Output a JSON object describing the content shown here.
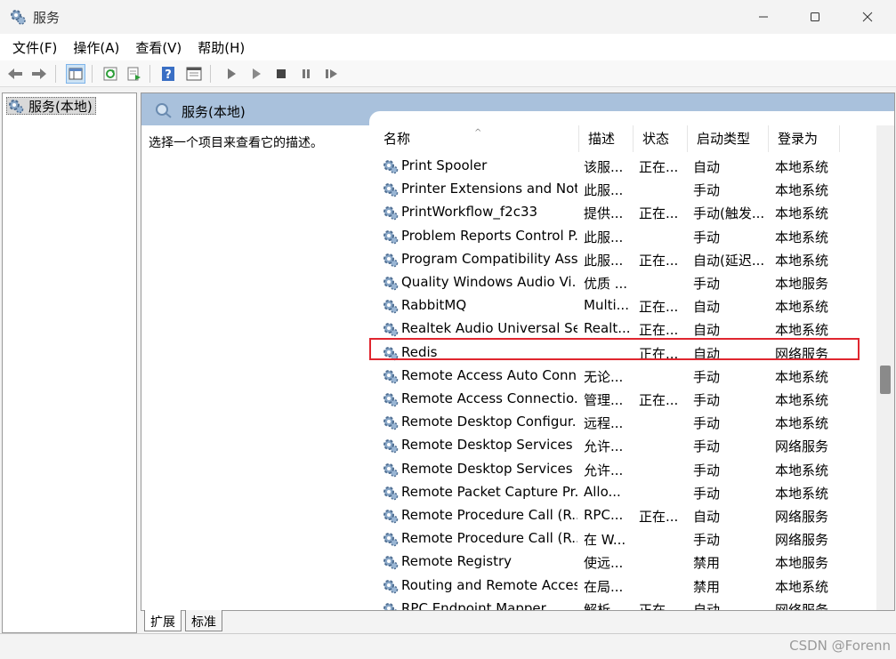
{
  "window": {
    "title": "服务"
  },
  "menu": [
    "文件(F)",
    "操作(A)",
    "查看(V)",
    "帮助(H)"
  ],
  "tree": {
    "root_label": "服务(本地)"
  },
  "panel": {
    "title": "服务(本地)",
    "description_hint": "选择一个项目来查看它的描述。"
  },
  "columns": {
    "name": "名称",
    "desc": "描述",
    "status": "状态",
    "startup": "启动类型",
    "logon": "登录为"
  },
  "services": [
    {
      "name": "Print Spooler",
      "desc": "该服...",
      "status": "正在...",
      "startup": "自动",
      "logon": "本地系统"
    },
    {
      "name": "Printer Extensions and Noti...",
      "desc": "此服...",
      "status": "",
      "startup": "手动",
      "logon": "本地系统"
    },
    {
      "name": "PrintWorkflow_f2c33",
      "desc": "提供...",
      "status": "正在...",
      "startup": "手动(触发...",
      "logon": "本地系统"
    },
    {
      "name": "Problem Reports Control P...",
      "desc": "此服...",
      "status": "",
      "startup": "手动",
      "logon": "本地系统"
    },
    {
      "name": "Program Compatibility Assi...",
      "desc": "此服...",
      "status": "正在...",
      "startup": "自动(延迟...",
      "logon": "本地系统"
    },
    {
      "name": "Quality Windows Audio Vi...",
      "desc": "优质 ...",
      "status": "",
      "startup": "手动",
      "logon": "本地服务"
    },
    {
      "name": "RabbitMQ",
      "desc": "Multi...",
      "status": "正在...",
      "startup": "自动",
      "logon": "本地系统"
    },
    {
      "name": "Realtek Audio Universal Se...",
      "desc": "Realt...",
      "status": "正在...",
      "startup": "自动",
      "logon": "本地系统"
    },
    {
      "name": "Redis",
      "desc": "",
      "status": "正在...",
      "startup": "自动",
      "logon": "网络服务"
    },
    {
      "name": "Remote Access Auto Conn...",
      "desc": "无论...",
      "status": "",
      "startup": "手动",
      "logon": "本地系统"
    },
    {
      "name": "Remote Access Connectio...",
      "desc": "管理...",
      "status": "正在...",
      "startup": "手动",
      "logon": "本地系统"
    },
    {
      "name": "Remote Desktop Configur...",
      "desc": "远程...",
      "status": "",
      "startup": "手动",
      "logon": "本地系统"
    },
    {
      "name": "Remote Desktop Services",
      "desc": "允许...",
      "status": "",
      "startup": "手动",
      "logon": "网络服务"
    },
    {
      "name": "Remote Desktop Services ...",
      "desc": "允许...",
      "status": "",
      "startup": "手动",
      "logon": "本地系统"
    },
    {
      "name": "Remote Packet Capture Pr...",
      "desc": "Allo...",
      "status": "",
      "startup": "手动",
      "logon": "本地系统"
    },
    {
      "name": "Remote Procedure Call (R...",
      "desc": "RPC...",
      "status": "正在...",
      "startup": "自动",
      "logon": "网络服务"
    },
    {
      "name": "Remote Procedure Call (R...",
      "desc": "在 W...",
      "status": "",
      "startup": "手动",
      "logon": "网络服务"
    },
    {
      "name": "Remote Registry",
      "desc": "使远...",
      "status": "",
      "startup": "禁用",
      "logon": "本地服务"
    },
    {
      "name": "Routing and Remote Access",
      "desc": "在局...",
      "status": "",
      "startup": "禁用",
      "logon": "本地系统"
    },
    {
      "name": "RPC Endpoint Mapper",
      "desc": "解析...",
      "status": "正在...",
      "startup": "自动",
      "logon": "网络服务"
    }
  ],
  "tabs": [
    "扩展",
    "标准"
  ],
  "watermark": "CSDN @Forenn"
}
